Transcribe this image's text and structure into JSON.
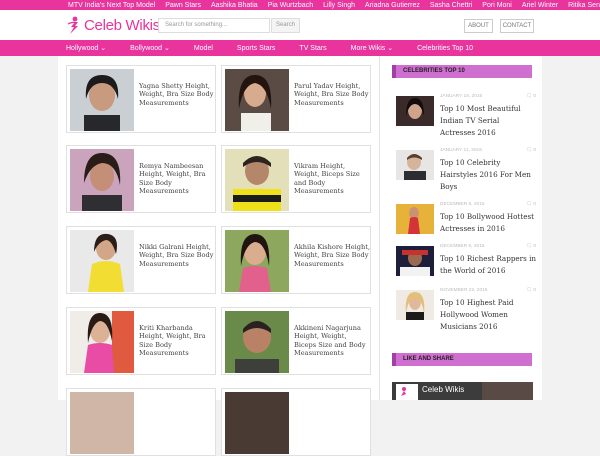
{
  "topbar": {
    "links": [
      "MTV India's Next Top Model",
      "Pawn Stars",
      "Aashika Bhatia",
      "Pia Wurtzbach",
      "Lilly Singh",
      "Ariadna Gutierrez",
      "Sasha Chettri",
      "Pori Moni",
      "Ariel Winter",
      "Ritika Sen"
    ]
  },
  "header": {
    "logo_text": "Celeb Wikis",
    "search_placeholder": "Search for something...",
    "search_button": "Search",
    "about_label": "ABOUT",
    "contact_label": "CONTACT"
  },
  "nav": {
    "items": [
      "Hollywood ⌄",
      "Bollywood ⌄",
      "Model",
      "Sports Stars",
      "TV Stars",
      "More Wikis ⌄",
      "Celebrities Top 10"
    ]
  },
  "articles": [
    {
      "title": "Yagna Shetty Height, Weight, Bra Size Body Measurements"
    },
    {
      "title": "Parul Yadav Height, Weight, Bra Size Body Measurements"
    },
    {
      "title": "Remya Nambeesan Height, Weight, Bra Size Body Measurements"
    },
    {
      "title": "Vikram Height, Weight, Biceps Size and Body Measurements"
    },
    {
      "title": "Nikki Galrani Height, Weight, Bra Size Body Measurements"
    },
    {
      "title": "Akhila Kishore Height, Weight, Bra Size Body Measurements"
    },
    {
      "title": "Kriti Kharbanda Height, Weight, Bra Size Body Measurements"
    },
    {
      "title": "Akkineni Nagarjuna Height, Weight, Biceps Size and Body Measurements"
    }
  ],
  "sidebar": {
    "top10_heading": "CELEBRITIES TOP 10",
    "items": [
      {
        "date": "JANUARY 18, 2016",
        "count": "0",
        "title": "Top 10 Most Beautiful Indian TV Serial Actresses 2016"
      },
      {
        "date": "JANUARY 11, 2016",
        "count": "0",
        "title": "Top 10 Celebrity Hairstyles 2016 For Men Boys"
      },
      {
        "date": "DECEMBER 8, 2015",
        "count": "0",
        "title": "Top 10 Bollywood Hottest Actresses in 2016"
      },
      {
        "date": "DECEMBER 6, 2015",
        "count": "0",
        "title": "Top 10 Richest Rappers in the World of 2016"
      },
      {
        "date": "NOVEMBER 22, 2015",
        "count": "0",
        "title": "Top 10 Highest Paid Hollywood Women Musicians 2016"
      }
    ],
    "share_heading": "LIKE AND SHARE",
    "fb_page_name": "Celeb Wikis"
  },
  "colors": {
    "brand_pink": "#e8349c",
    "sidebar_heading": "#cf6fcf"
  }
}
